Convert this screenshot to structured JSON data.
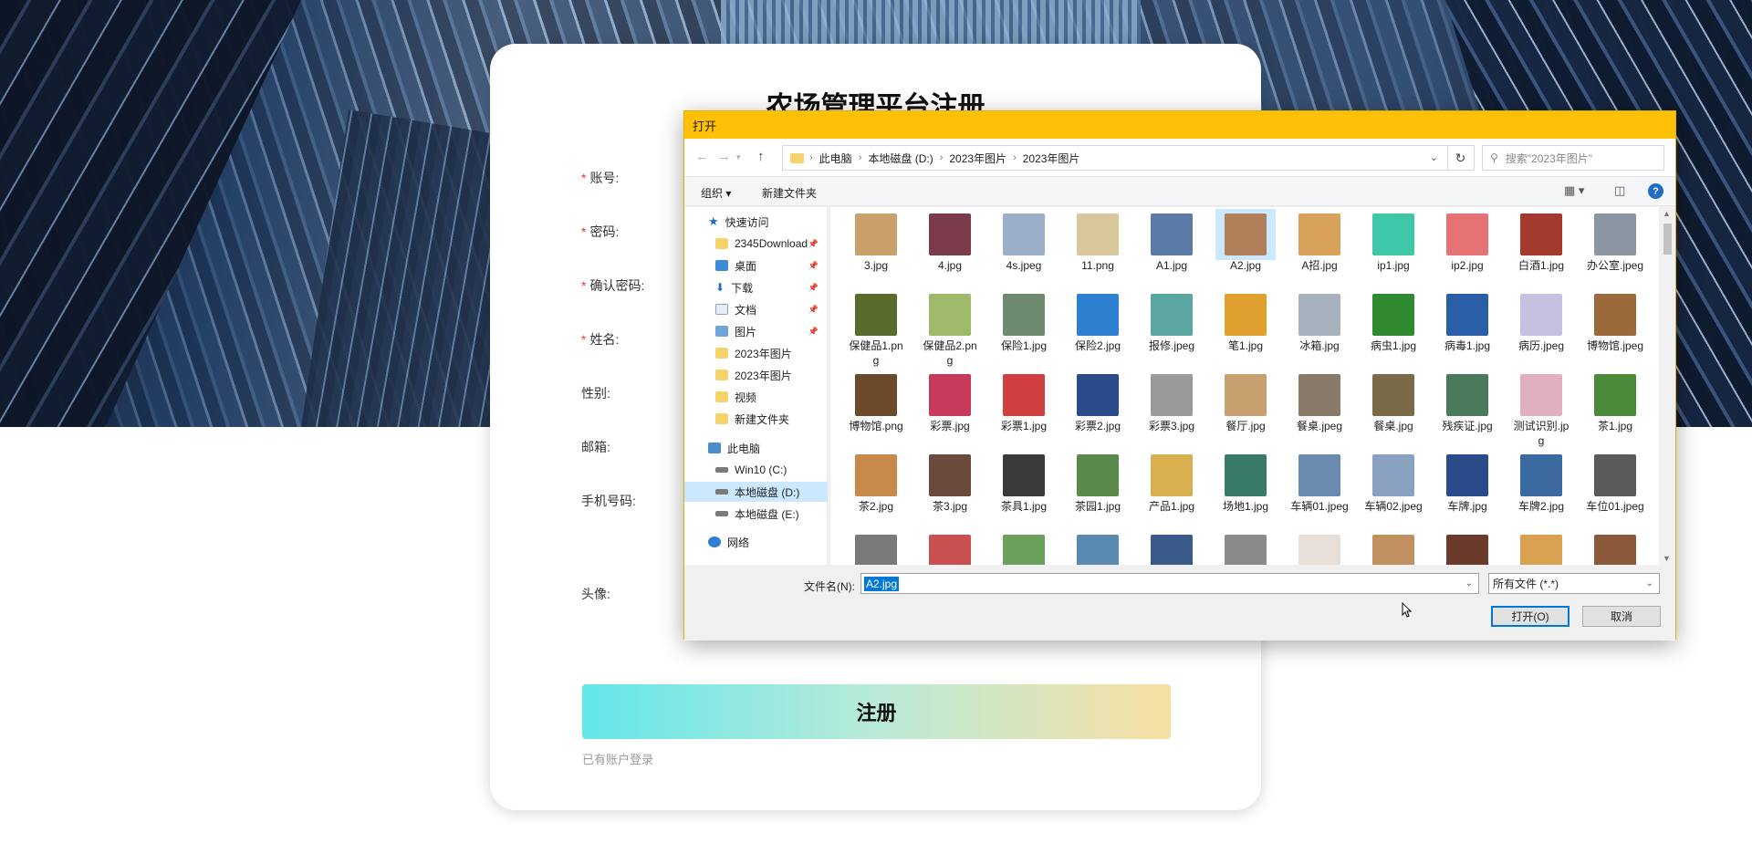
{
  "page": {
    "title": "农场管理平台注册",
    "fields": [
      {
        "label": "账号:",
        "required": true
      },
      {
        "label": "密码:",
        "required": true
      },
      {
        "label": "确认密码:",
        "required": true
      },
      {
        "label": "姓名:",
        "required": true
      },
      {
        "label": "性别:",
        "required": false
      },
      {
        "label": "邮箱:",
        "required": false
      },
      {
        "label": "手机号码:",
        "required": false
      },
      {
        "label": "头像:",
        "required": false
      }
    ],
    "register_label": "注册",
    "login_link": "已有账户登录"
  },
  "dialog": {
    "title": "打开",
    "breadcrumb": [
      "此电脑",
      "本地磁盘 (D:)",
      "2023年图片",
      "2023年图片"
    ],
    "search_placeholder": "搜索\"2023年图片\"",
    "toolbar": {
      "organize": "组织 ▾",
      "new_folder": "新建文件夹"
    },
    "nav": [
      {
        "label": "快速访问",
        "icon": "star-icon"
      },
      {
        "label": "2345Download",
        "icon": "folder-icon",
        "pinned": true
      },
      {
        "label": "桌面",
        "icon": "desktop-icon",
        "pinned": true
      },
      {
        "label": "下载",
        "icon": "download-icon",
        "pinned": true
      },
      {
        "label": "文档",
        "icon": "document-icon",
        "pinned": true
      },
      {
        "label": "图片",
        "icon": "picture-icon",
        "pinned": true
      },
      {
        "label": "2023年图片",
        "icon": "folder-icon"
      },
      {
        "label": "2023年图片",
        "icon": "folder-icon"
      },
      {
        "label": "视频",
        "icon": "folder-icon"
      },
      {
        "label": "新建文件夹",
        "icon": "folder-icon"
      },
      {
        "label": "此电脑",
        "icon": "computer-icon"
      },
      {
        "label": "Win10 (C:)",
        "icon": "drive-icon"
      },
      {
        "label": "本地磁盘 (D:)",
        "icon": "drive-icon",
        "selected": true
      },
      {
        "label": "本地磁盘 (E:)",
        "icon": "drive-icon"
      },
      {
        "label": "网络",
        "icon": "network-icon"
      }
    ],
    "files": [
      {
        "name": "3.jpg",
        "color": "#c9a06a"
      },
      {
        "name": "4.jpg",
        "color": "#7b3b4a"
      },
      {
        "name": "4s.jpeg",
        "color": "#9bb0c8"
      },
      {
        "name": "11.png",
        "color": "#d8c79a"
      },
      {
        "name": "A1.jpg",
        "color": "#5c7aa8"
      },
      {
        "name": "A2.jpg",
        "color": "#b0805a",
        "selected": true
      },
      {
        "name": "A招.jpg",
        "color": "#d9a25a"
      },
      {
        "name": "ip1.jpg",
        "color": "#3ec8a8"
      },
      {
        "name": "ip2.jpg",
        "color": "#e57373"
      },
      {
        "name": "白酒1.jpg",
        "color": "#a33a2e"
      },
      {
        "name": "办公室.jpeg",
        "color": "#8c96a3"
      },
      {
        "name": "保健品1.png",
        "color": "#5a6b2e"
      },
      {
        "name": "保健品2.png",
        "color": "#9fb96a"
      },
      {
        "name": "保险1.jpg",
        "color": "#6e8a6e"
      },
      {
        "name": "保险2.jpg",
        "color": "#2d7fd0"
      },
      {
        "name": "报修.jpeg",
        "color": "#5aa6a0"
      },
      {
        "name": "笔1.jpg",
        "color": "#e0a030"
      },
      {
        "name": "冰箱.jpg",
        "color": "#a8b2bc"
      },
      {
        "name": "病虫1.jpg",
        "color": "#2f8a2f"
      },
      {
        "name": "病毒1.jpg",
        "color": "#2a5fa8"
      },
      {
        "name": "病历.jpeg",
        "color": "#c8c0e0"
      },
      {
        "name": "博物馆.jpeg",
        "color": "#9a6a3a"
      },
      {
        "name": "博物馆.png",
        "color": "#6a4a2a"
      },
      {
        "name": "彩票.jpg",
        "color": "#c83a5a"
      },
      {
        "name": "彩票1.jpg",
        "color": "#d04040"
      },
      {
        "name": "彩票2.jpg",
        "color": "#2a4a8a"
      },
      {
        "name": "彩票3.jpg",
        "color": "#9a9a9a"
      },
      {
        "name": "餐厅.jpg",
        "color": "#c8a070"
      },
      {
        "name": "餐桌.jpeg",
        "color": "#8a7a6a"
      },
      {
        "name": "餐桌.jpg",
        "color": "#7a6a4a"
      },
      {
        "name": "残疾证.jpg",
        "color": "#4a7a5a"
      },
      {
        "name": "测试识别.jpg",
        "color": "#e0b0c0"
      },
      {
        "name": "茶1.jpg",
        "color": "#4a8a3a"
      },
      {
        "name": "茶2.jpg",
        "color": "#c88a4a"
      },
      {
        "name": "茶3.jpg",
        "color": "#6a4a3a"
      },
      {
        "name": "茶具1.jpg",
        "color": "#3a3a3a"
      },
      {
        "name": "茶园1.jpg",
        "color": "#5a8a4a"
      },
      {
        "name": "产品1.jpg",
        "color": "#d8b050"
      },
      {
        "name": "场地1.jpg",
        "color": "#3a7a6a"
      },
      {
        "name": "车辆01.jpeg",
        "color": "#6a8ab0"
      },
      {
        "name": "车辆02.jpeg",
        "color": "#8aa0c0"
      },
      {
        "name": "车牌.jpg",
        "color": "#2a4a8a"
      },
      {
        "name": "车牌2.jpg",
        "color": "#3a6aa0"
      },
      {
        "name": "车位01.jpeg",
        "color": "#5a5a5a"
      },
      {
        "name": "",
        "color": "#7a7a7a"
      },
      {
        "name": "",
        "color": "#c85050"
      },
      {
        "name": "",
        "color": "#6aa05a"
      },
      {
        "name": "",
        "color": "#5a8ab0"
      },
      {
        "name": "",
        "color": "#3a5a8a"
      },
      {
        "name": "",
        "color": "#8a8a8a"
      },
      {
        "name": "",
        "color": "#e8e0d8"
      },
      {
        "name": "",
        "color": "#c09060"
      },
      {
        "name": "",
        "color": "#6a3a2a"
      },
      {
        "name": "",
        "color": "#d8a050"
      },
      {
        "name": "",
        "color": "#8a5a3a"
      }
    ],
    "filename_label": "文件名(N):",
    "filename_value": "A2.jpg",
    "filetype": "所有文件 (*.*)",
    "open_label": "打开(O)",
    "cancel_label": "取消"
  }
}
